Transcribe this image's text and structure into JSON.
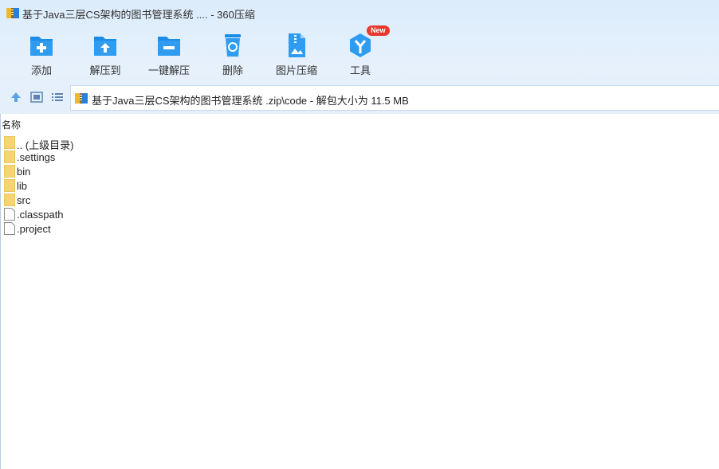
{
  "window": {
    "title": "基于Java三层CS架构的图书管理系统 .... - 360压缩"
  },
  "toolbar": {
    "items": [
      {
        "label": "添加",
        "icon": "add-folder-icon"
      },
      {
        "label": "解压到",
        "icon": "extract-to-icon"
      },
      {
        "label": "一键解压",
        "icon": "one-click-extract-icon"
      },
      {
        "label": "删除",
        "icon": "recycle-bin-icon"
      },
      {
        "label": "图片压缩",
        "icon": "image-compress-icon"
      },
      {
        "label": "工具",
        "icon": "tools-cube-icon",
        "badge": "New"
      }
    ]
  },
  "nav": {
    "up_icon": "arrow-up-icon",
    "view_icon": "view-thumbnail-icon",
    "list_icon": "view-list-icon"
  },
  "address": {
    "path": "基于Java三层CS架构的图书管理系统 .zip\\code - 解包大小为 11.5 MB"
  },
  "columns": {
    "name": "名称"
  },
  "files": [
    {
      "name": ".. (上级目录)",
      "type": "folder"
    },
    {
      "name": ".settings",
      "type": "folder"
    },
    {
      "name": "bin",
      "type": "folder"
    },
    {
      "name": "lib",
      "type": "folder"
    },
    {
      "name": "src",
      "type": "folder"
    },
    {
      "name": ".classpath",
      "type": "file"
    },
    {
      "name": ".project",
      "type": "file"
    }
  ],
  "colors": {
    "accent": "#1a8de8",
    "folder": "#f7d46f",
    "badge": "#e8382f"
  }
}
